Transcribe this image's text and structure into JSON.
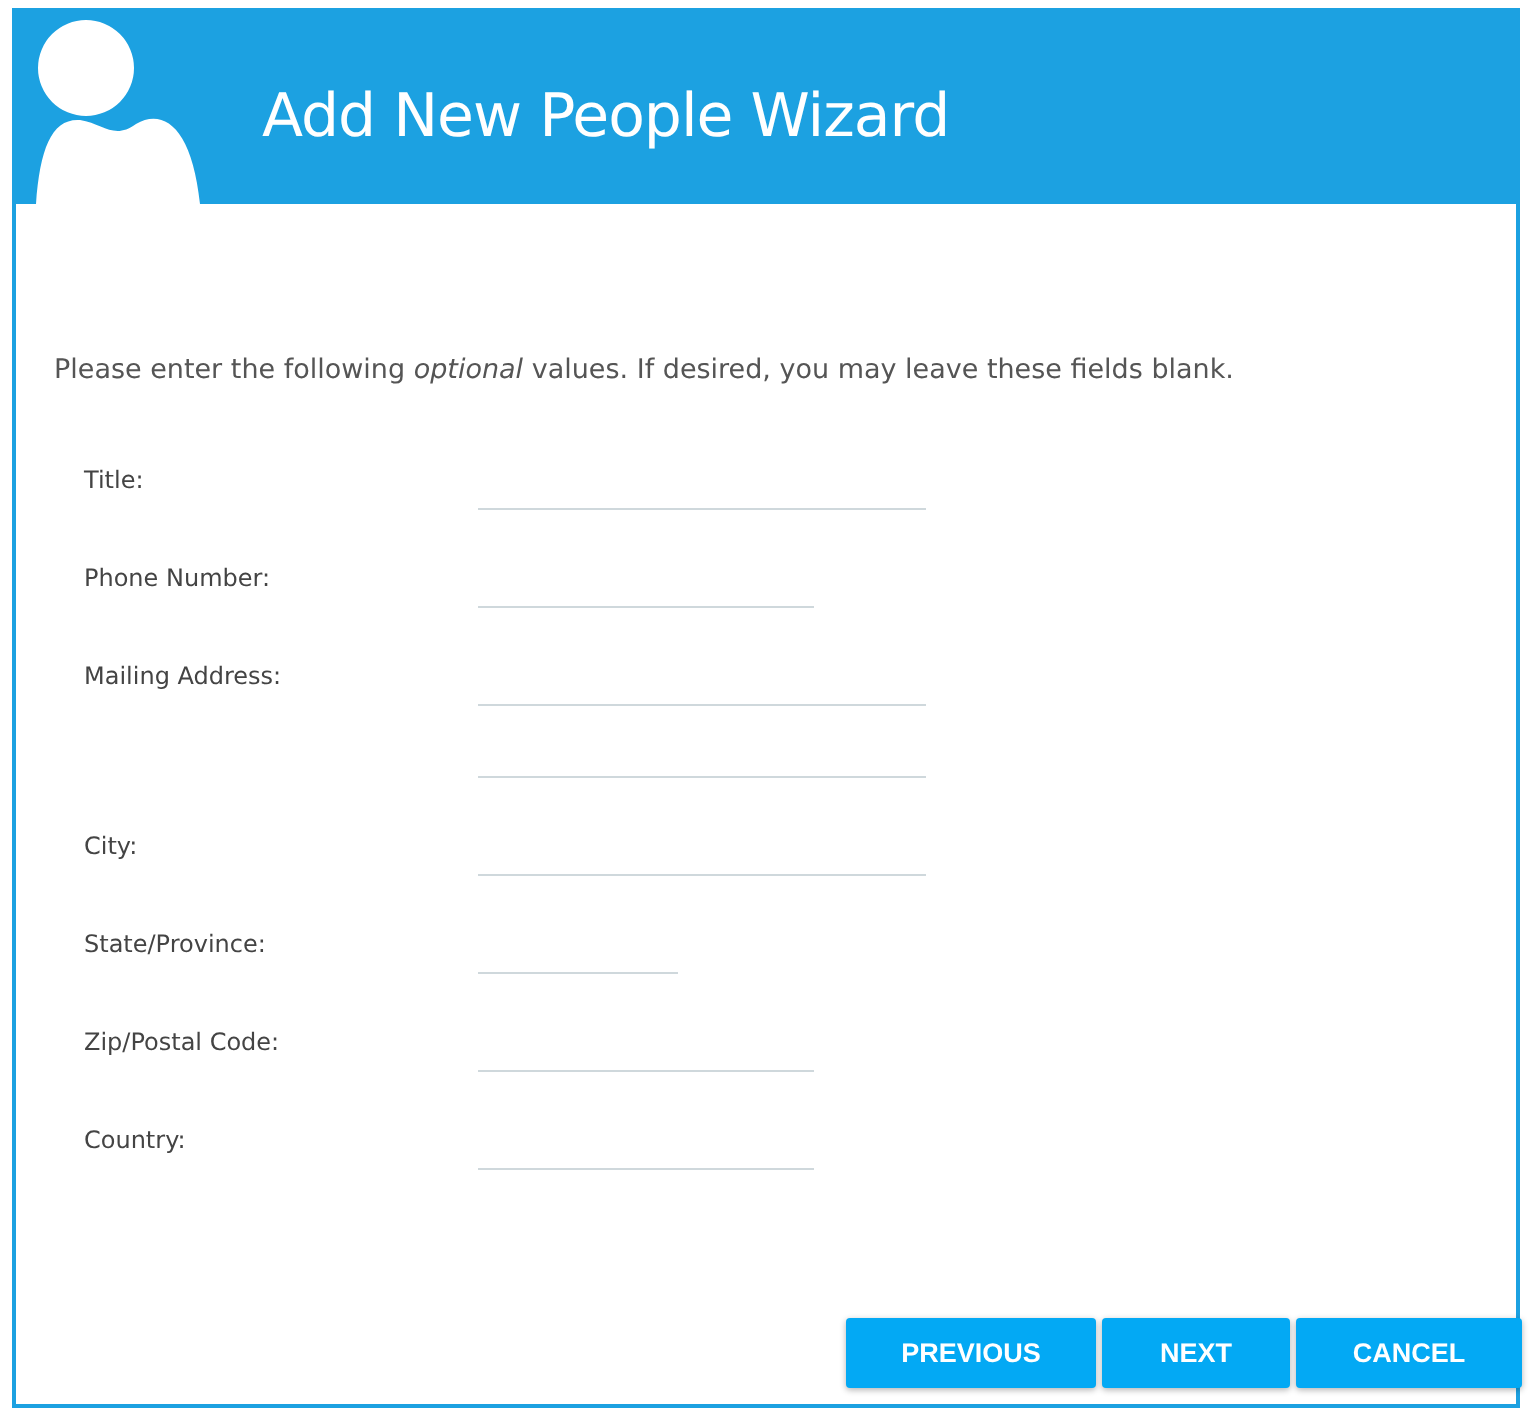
{
  "window": {
    "title": "Add New People Wizard"
  },
  "intro": "Please enter the following *optional* values. If desired, you may leave these fields blank.",
  "fields": [
    {
      "label": "Title:",
      "inputs": [
        {
          "kind": "long"
        }
      ]
    },
    {
      "label": "Phone Number:",
      "inputs": [
        {
          "kind": "medium"
        }
      ]
    },
    {
      "label": "Mailing Address:",
      "inputs": [
        {
          "kind": "long"
        },
        {
          "kind": "long"
        }
      ]
    },
    {
      "label": "City:",
      "inputs": [
        {
          "kind": "long"
        }
      ]
    },
    {
      "label": "State/Province:",
      "inputs": [
        {
          "kind": "short"
        }
      ]
    },
    {
      "label": "Zip/Postal Code:",
      "inputs": [
        {
          "kind": "medium"
        }
      ]
    },
    {
      "label": "Country:",
      "inputs": [
        {
          "kind": "medium"
        }
      ]
    }
  ],
  "buttons": [
    "PREVIOUS",
    "NEXT",
    "CANCEL"
  ]
}
